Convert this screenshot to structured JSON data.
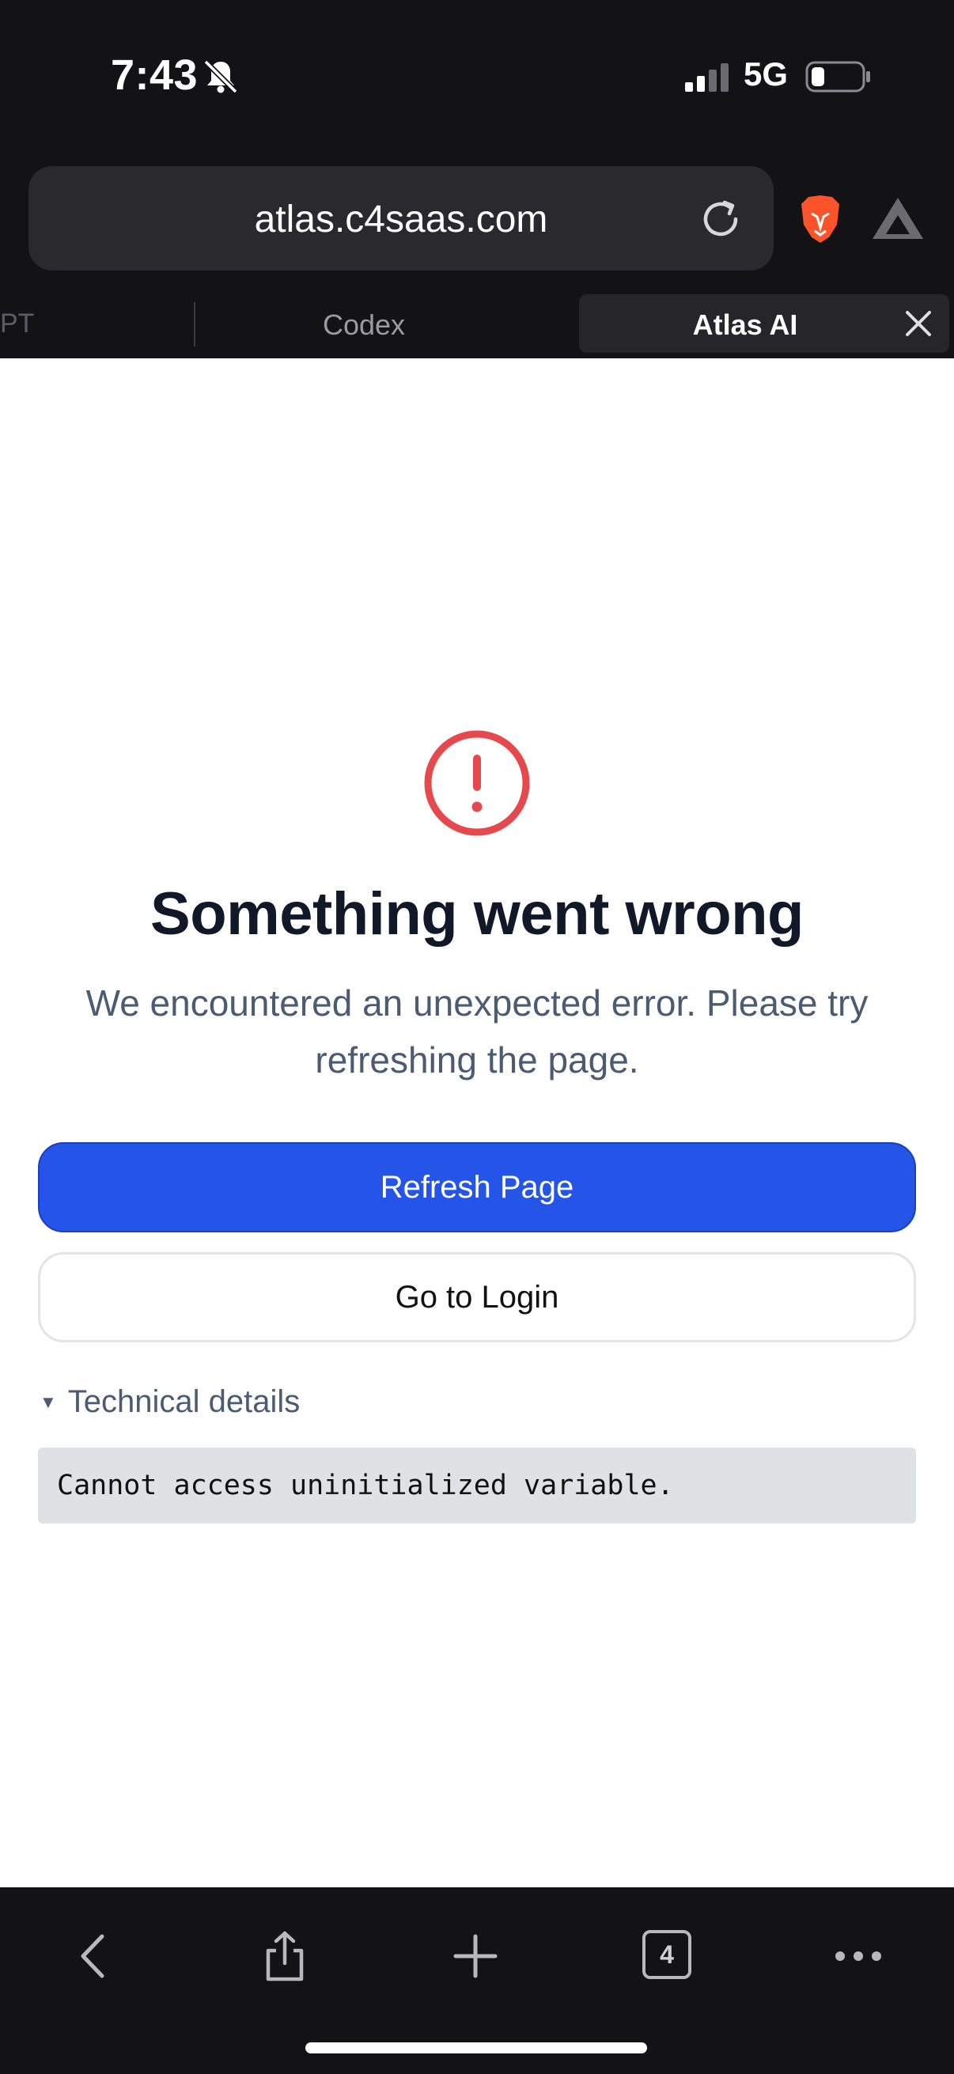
{
  "status_bar": {
    "time": "7:43",
    "network": "5G",
    "icons": [
      "bell-slash-icon",
      "signal-icon",
      "battery-icon"
    ]
  },
  "browser": {
    "url": "atlas.c4saas.com",
    "icons": [
      "reload-icon",
      "brave-lion-icon",
      "brave-rewards-icon"
    ],
    "tabs": [
      {
        "label": "PT",
        "active": false
      },
      {
        "label": "Codex",
        "active": false
      },
      {
        "label": "Atlas AI",
        "active": true
      }
    ]
  },
  "error": {
    "title": "Something went wrong",
    "message": "We encountered an unexpected error. Please try refreshing the page.",
    "refresh_label": "Refresh Page",
    "login_label": "Go to Login",
    "details_label": "Technical details",
    "details_text": "Cannot access uninitialized variable."
  },
  "toolbar": {
    "tab_count": "4",
    "icons": [
      "back-icon",
      "share-icon",
      "new-tab-icon",
      "tabs-icon",
      "more-icon"
    ]
  },
  "colors": {
    "chrome_bg": "#131316",
    "primary": "#2454e8",
    "error_red": "#e5484d",
    "muted_text": "#4b5b72"
  }
}
